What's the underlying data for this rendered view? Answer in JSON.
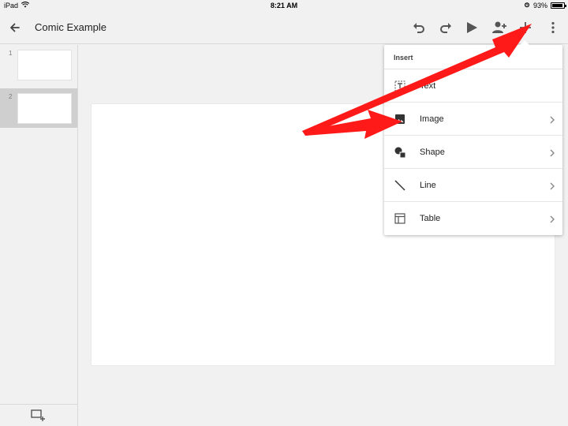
{
  "status_bar": {
    "device": "iPad",
    "time": "8:21 AM",
    "battery": "93%",
    "battery_level": 0.93
  },
  "app_bar": {
    "title": "Comic Example",
    "icons": [
      "back-arrow-icon",
      "undo-icon",
      "redo-icon",
      "present-play-icon",
      "share-person-add-icon",
      "insert-plus-icon",
      "more-vert-icon"
    ]
  },
  "slides": {
    "items": [
      {
        "number": "1",
        "selected": false
      },
      {
        "number": "2",
        "selected": true
      }
    ],
    "add_slide_icon": "add-slide-icon"
  },
  "insert_menu": {
    "header": "Insert",
    "items": [
      {
        "label": "Text",
        "icon": "text-box-icon",
        "has_submenu": false
      },
      {
        "label": "Image",
        "icon": "image-icon",
        "has_submenu": true
      },
      {
        "label": "Shape",
        "icon": "shape-icon",
        "has_submenu": true
      },
      {
        "label": "Line",
        "icon": "line-icon",
        "has_submenu": true
      },
      {
        "label": "Table",
        "icon": "table-icon",
        "has_submenu": true
      }
    ]
  },
  "colors": {
    "annotation_arrow": "#ff1a1a",
    "chrome_background": "#f1f1f1",
    "selected_slide": "#cfcfcf"
  }
}
